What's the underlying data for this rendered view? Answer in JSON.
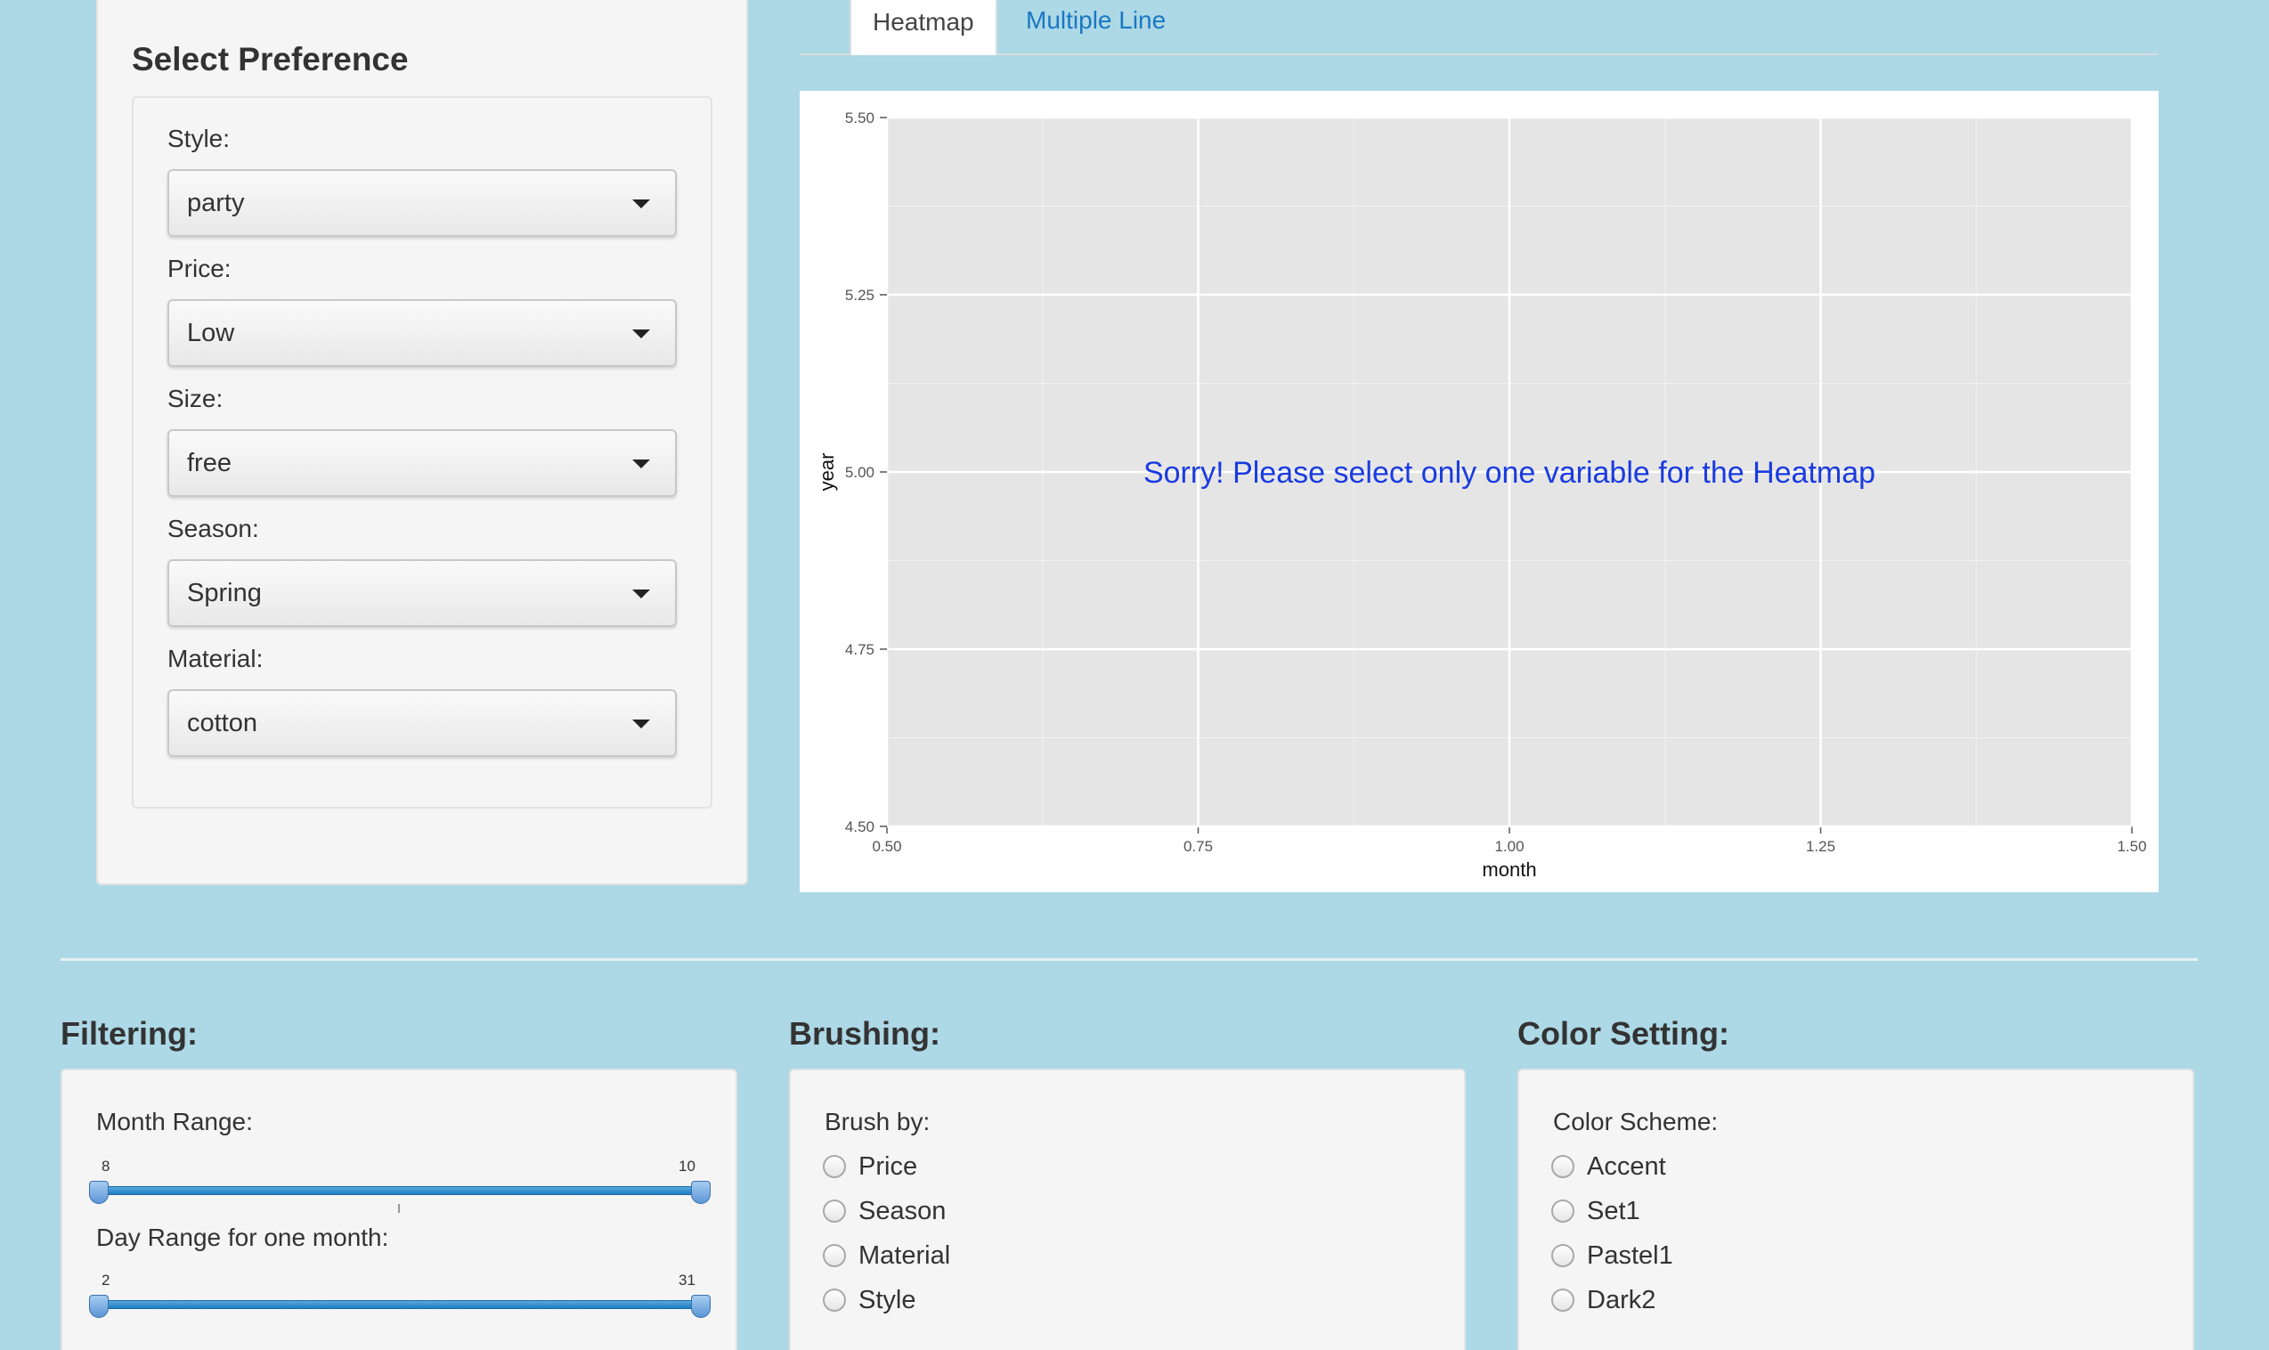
{
  "preference": {
    "title": "Select Preference",
    "fields": [
      {
        "label": "Style:",
        "value": "party"
      },
      {
        "label": "Price:",
        "value": "Low"
      },
      {
        "label": "Size:",
        "value": "free"
      },
      {
        "label": "Season:",
        "value": "Spring"
      },
      {
        "label": "Material:",
        "value": "cotton"
      }
    ]
  },
  "tabs": [
    {
      "label": "Heatmap",
      "active": true
    },
    {
      "label": "Multiple Line",
      "active": false
    }
  ],
  "chart_data": {
    "type": "heatmap",
    "xlabel": "month",
    "ylabel": "year",
    "xlim": [
      0.5,
      1.5
    ],
    "ylim": [
      4.5,
      5.5
    ],
    "x_ticks": [
      "0.50",
      "0.75",
      "1.00",
      "1.25",
      "1.50"
    ],
    "y_ticks": [
      "4.50",
      "4.75",
      "5.00",
      "5.25",
      "5.50"
    ],
    "grid": true,
    "values": [],
    "message": "Sorry! Please select only one variable for the Heatmap",
    "colors": {
      "panel_bg": "#e5e5e5",
      "grid": "#ffffff",
      "message": "#1a3be0"
    }
  },
  "filtering": {
    "title": "Filtering:",
    "month_range": {
      "label": "Month Range:",
      "min_label": "8",
      "max_label": "10"
    },
    "day_range": {
      "label": "Day Range for one month:",
      "min_label": "2",
      "max_label": "31"
    }
  },
  "brushing": {
    "title": "Brushing:",
    "label": "Brush by:",
    "options": [
      "Price",
      "Season",
      "Material",
      "Style"
    ]
  },
  "color_setting": {
    "title": "Color Setting:",
    "label": "Color Scheme:",
    "options": [
      "Accent",
      "Set1",
      "Pastel1",
      "Dark2"
    ]
  },
  "theme": {
    "background": "#add8e6",
    "link": "#1a78c2"
  }
}
